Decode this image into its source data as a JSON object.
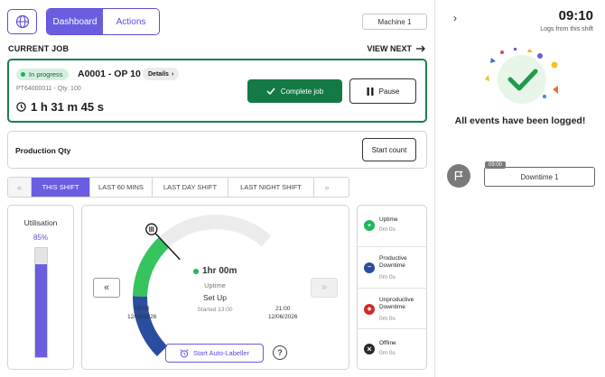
{
  "header": {
    "tabs": [
      {
        "label": "Dashboard",
        "active": true
      },
      {
        "label": "Actions",
        "active": false
      }
    ],
    "machine_select": "Machine 1",
    "icon": "globe-icon"
  },
  "current_job": {
    "section_title": "CURRENT JOB",
    "view_next_label": "VIEW NEXT",
    "status": "In progress",
    "job_id": "A0001 - OP 10",
    "details_label": "Details",
    "sub": "PT64000011 - Qty. 100",
    "elapsed": "1 h 31 m 45 s",
    "complete_label": "Complete job",
    "pause_label": "Pause",
    "accent": "#137a45"
  },
  "production": {
    "label": "Production Qty",
    "start_count_label": "Start count"
  },
  "time_tabs": {
    "items": [
      {
        "label": "THIS SHIFT",
        "selected": true
      },
      {
        "label": "LAST 60 MINS",
        "selected": false
      },
      {
        "label": "LAST DAY SHIFT",
        "selected": false
      },
      {
        "label": "LAST NIGHT SHIFT",
        "selected": false
      }
    ]
  },
  "utilisation": {
    "title": "Utilisation",
    "value_text": "85%",
    "value": 0.85,
    "color": "#6a5de0"
  },
  "gauge": {
    "current_value": "1hr 00m",
    "current_label": "Uptime",
    "state": "Set Up",
    "started": "Started 13:00",
    "start_time": "09:00",
    "start_date": "12/06/2026",
    "end_time": "21:00",
    "end_date": "12/06/2026",
    "segments": [
      {
        "name": "Productive Downtime",
        "fraction": 0.17,
        "color": "#2b4da0"
      },
      {
        "name": "Uptime",
        "fraction": 0.17,
        "color": "#35c45e"
      }
    ],
    "progress": 0.34,
    "auto_labeller_label": "Start Auto-Labeller",
    "help_label": "?"
  },
  "legend": {
    "items": [
      {
        "name": "Uptime",
        "time": "0m 0s",
        "color": "#21b65a",
        "icon": "plus-icon",
        "glyph": "+"
      },
      {
        "name": "Productive Downtime",
        "time": "0m 0s",
        "color": "#2b4da0",
        "icon": "minus-icon",
        "glyph": "−"
      },
      {
        "name": "Unproductive Downtime",
        "time": "0m 0s",
        "color": "#d02b2b",
        "icon": "diamond-icon",
        "glyph": "◆"
      },
      {
        "name": "Offline",
        "time": "0m 0s",
        "color": "#2a2a2a",
        "icon": "x-icon",
        "glyph": "×"
      }
    ]
  },
  "side": {
    "clock": "09:10",
    "subtitle": "Logs from this shift",
    "message": "All events have been logged!",
    "event": {
      "time": "09:00",
      "label": "Downtime 1"
    }
  }
}
